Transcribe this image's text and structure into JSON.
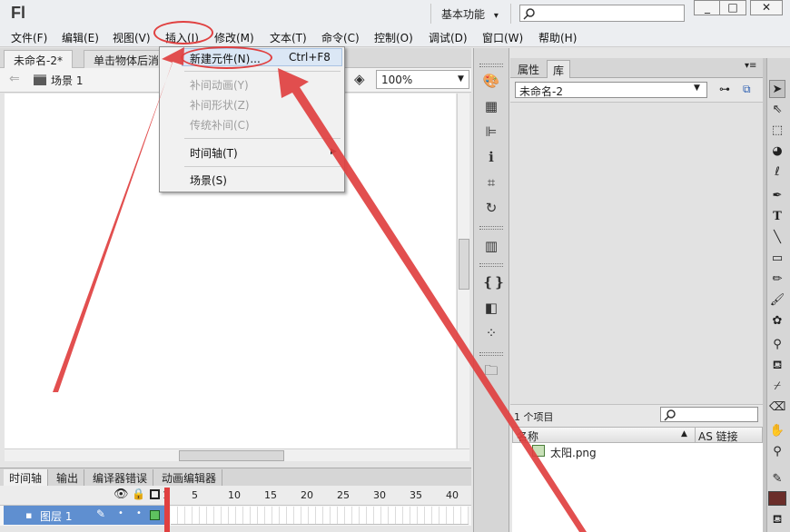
{
  "app": {
    "logo": "Fl",
    "workspace": "基本功能",
    "workspace_arrow": "▾",
    "window_buttons": [
      "_",
      "□",
      "✕"
    ]
  },
  "menu": [
    "文件(F)",
    "编辑(E)",
    "视图(V)",
    "插入(I)",
    "修改(M)",
    "文本(T)",
    "命令(C)",
    "控制(O)",
    "调试(D)",
    "窗口(W)",
    "帮助(H)"
  ],
  "document": {
    "tabs": [
      "未命名-2*",
      "单击物体后消"
    ],
    "scene": "场景 1",
    "zoom": "100%"
  },
  "insert_menu": {
    "new_symbol": "新建元件(N)...",
    "new_symbol_shortcut": "Ctrl+F8",
    "motion_tween": "补间动画(Y)",
    "shape_tween": "补间形状(Z)",
    "classic_tween": "传统补间(C)",
    "timeline": "时间轴(T)",
    "scene": "场景(S)"
  },
  "timeline": {
    "tabs": [
      "时间轴",
      "输出",
      "编译器错误",
      "动画编辑器"
    ],
    "frame_numbers": [
      "1",
      "5",
      "10",
      "15",
      "20",
      "25",
      "30",
      "35",
      "40"
    ],
    "layer_name": "图层 1"
  },
  "library": {
    "tabs": [
      "属性",
      "库"
    ],
    "document": "未命名-2",
    "item_count": "1 个项目",
    "col_name": "名称",
    "col_linkage": "AS 链接",
    "items": [
      "太阳.png"
    ]
  },
  "colors": {
    "stroke": "#1a1a1a",
    "fill": "#6b2e2a",
    "annotation": "#e04040"
  }
}
